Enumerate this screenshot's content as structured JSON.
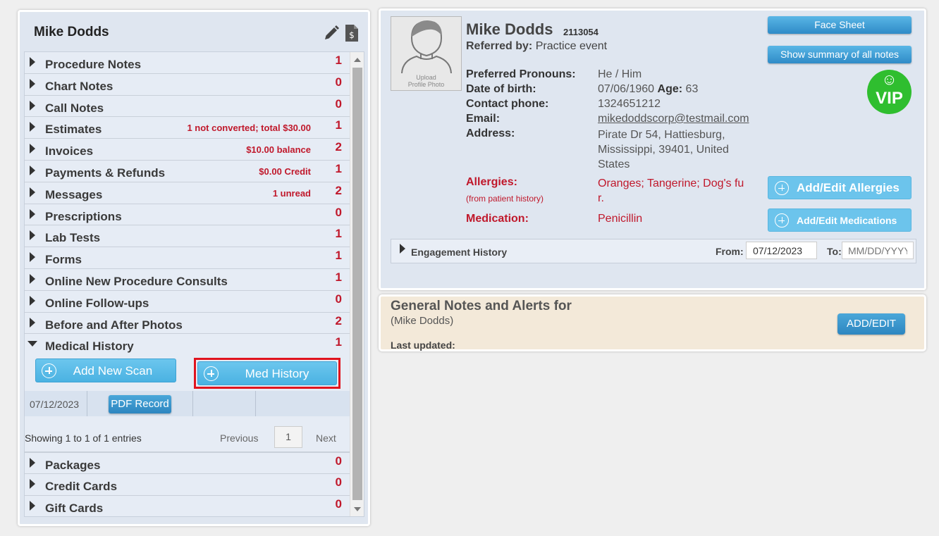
{
  "patient": {
    "name": "Mike Dodds",
    "id": "2113054",
    "referred_label": "Referred by:",
    "referred_value": "Practice event",
    "upload_line1": "Upload",
    "upload_line2": "Profile Photo"
  },
  "sections_top": [
    {
      "label": "Procedure Notes",
      "note": "",
      "count": "1"
    },
    {
      "label": "Chart Notes",
      "note": "",
      "count": "0"
    },
    {
      "label": "Call Notes",
      "note": "",
      "count": "0"
    },
    {
      "label": "Estimates",
      "note": "1 not converted; total $30.00",
      "count": "1"
    },
    {
      "label": "Invoices",
      "note": "$10.00 balance",
      "count": "2"
    },
    {
      "label": "Payments & Refunds",
      "note": "$0.00 Credit",
      "count": "1"
    },
    {
      "label": "Messages",
      "note": "1 unread",
      "count": "2"
    },
    {
      "label": "Prescriptions",
      "note": "",
      "count": "0"
    },
    {
      "label": "Lab Tests",
      "note": "",
      "count": "1"
    },
    {
      "label": "Forms",
      "note": "",
      "count": "1"
    },
    {
      "label": "Online New Procedure Consults",
      "note": "",
      "count": "1"
    },
    {
      "label": "Online Follow-ups",
      "note": "",
      "count": "0"
    },
    {
      "label": "Before and After Photos",
      "note": "",
      "count": "2"
    }
  ],
  "medical_history": {
    "label": "Medical History",
    "count": "1",
    "add_scan_label": "Add New Scan",
    "med_history_label": "Med History",
    "record_date": "07/12/2023",
    "pdf_button": "PDF Record",
    "showing": "Showing 1 to 1 of 1 entries",
    "previous": "Previous",
    "page": "1",
    "next": "Next"
  },
  "sections_bottom": [
    {
      "label": "Packages",
      "count": "0"
    },
    {
      "label": "Credit Cards",
      "count": "0"
    },
    {
      "label": "Gift Cards",
      "count": "0"
    }
  ],
  "details": {
    "pronouns_label": "Preferred Pronouns:",
    "pronouns": "He / Him",
    "dob_label": "Date of birth:",
    "dob": "07/06/1960",
    "age_label": "Age:",
    "age": "63",
    "phone_label": "Contact phone:",
    "phone": "1324651212",
    "email_label": "Email:",
    "email": "mikedoddscorp@testmail.com",
    "address_label": "Address:",
    "address_line1": "Pirate Dr 54, Hattiesburg,",
    "address_line2": "Mississippi, 39401, United",
    "address_line3": "States",
    "allergies_label": "Allergies:",
    "allergies_sub": "(from patient history)",
    "allergies_line1": "Oranges; Tangerine; Dog's fu",
    "allergies_line2": "r.",
    "medication_label": "Medication:",
    "medication": "Penicillin"
  },
  "buttons": {
    "face_sheet": "Face Sheet",
    "summary": "Show summary of all notes",
    "vip_smile": "☺",
    "vip": "VIP",
    "add_allergies": "Add/Edit Allergies",
    "add_medications": "Add/Edit Medications"
  },
  "engagement": {
    "title": "Engagement History",
    "from_label": "From:",
    "from_value": "07/12/2023",
    "to_label": "To:",
    "to_placeholder": "MM/DD/YYYY"
  },
  "notes": {
    "title": "General Notes and Alerts for",
    "subtitle": "(Mike Dodds)",
    "last_updated": "Last updated:",
    "add_edit": "ADD/EDIT"
  },
  "colors": {
    "accent_blue": "#4ab2e2",
    "count_red": "#c0182b",
    "vip_green": "#2fbe2f",
    "highlight_red": "#e0141e"
  }
}
